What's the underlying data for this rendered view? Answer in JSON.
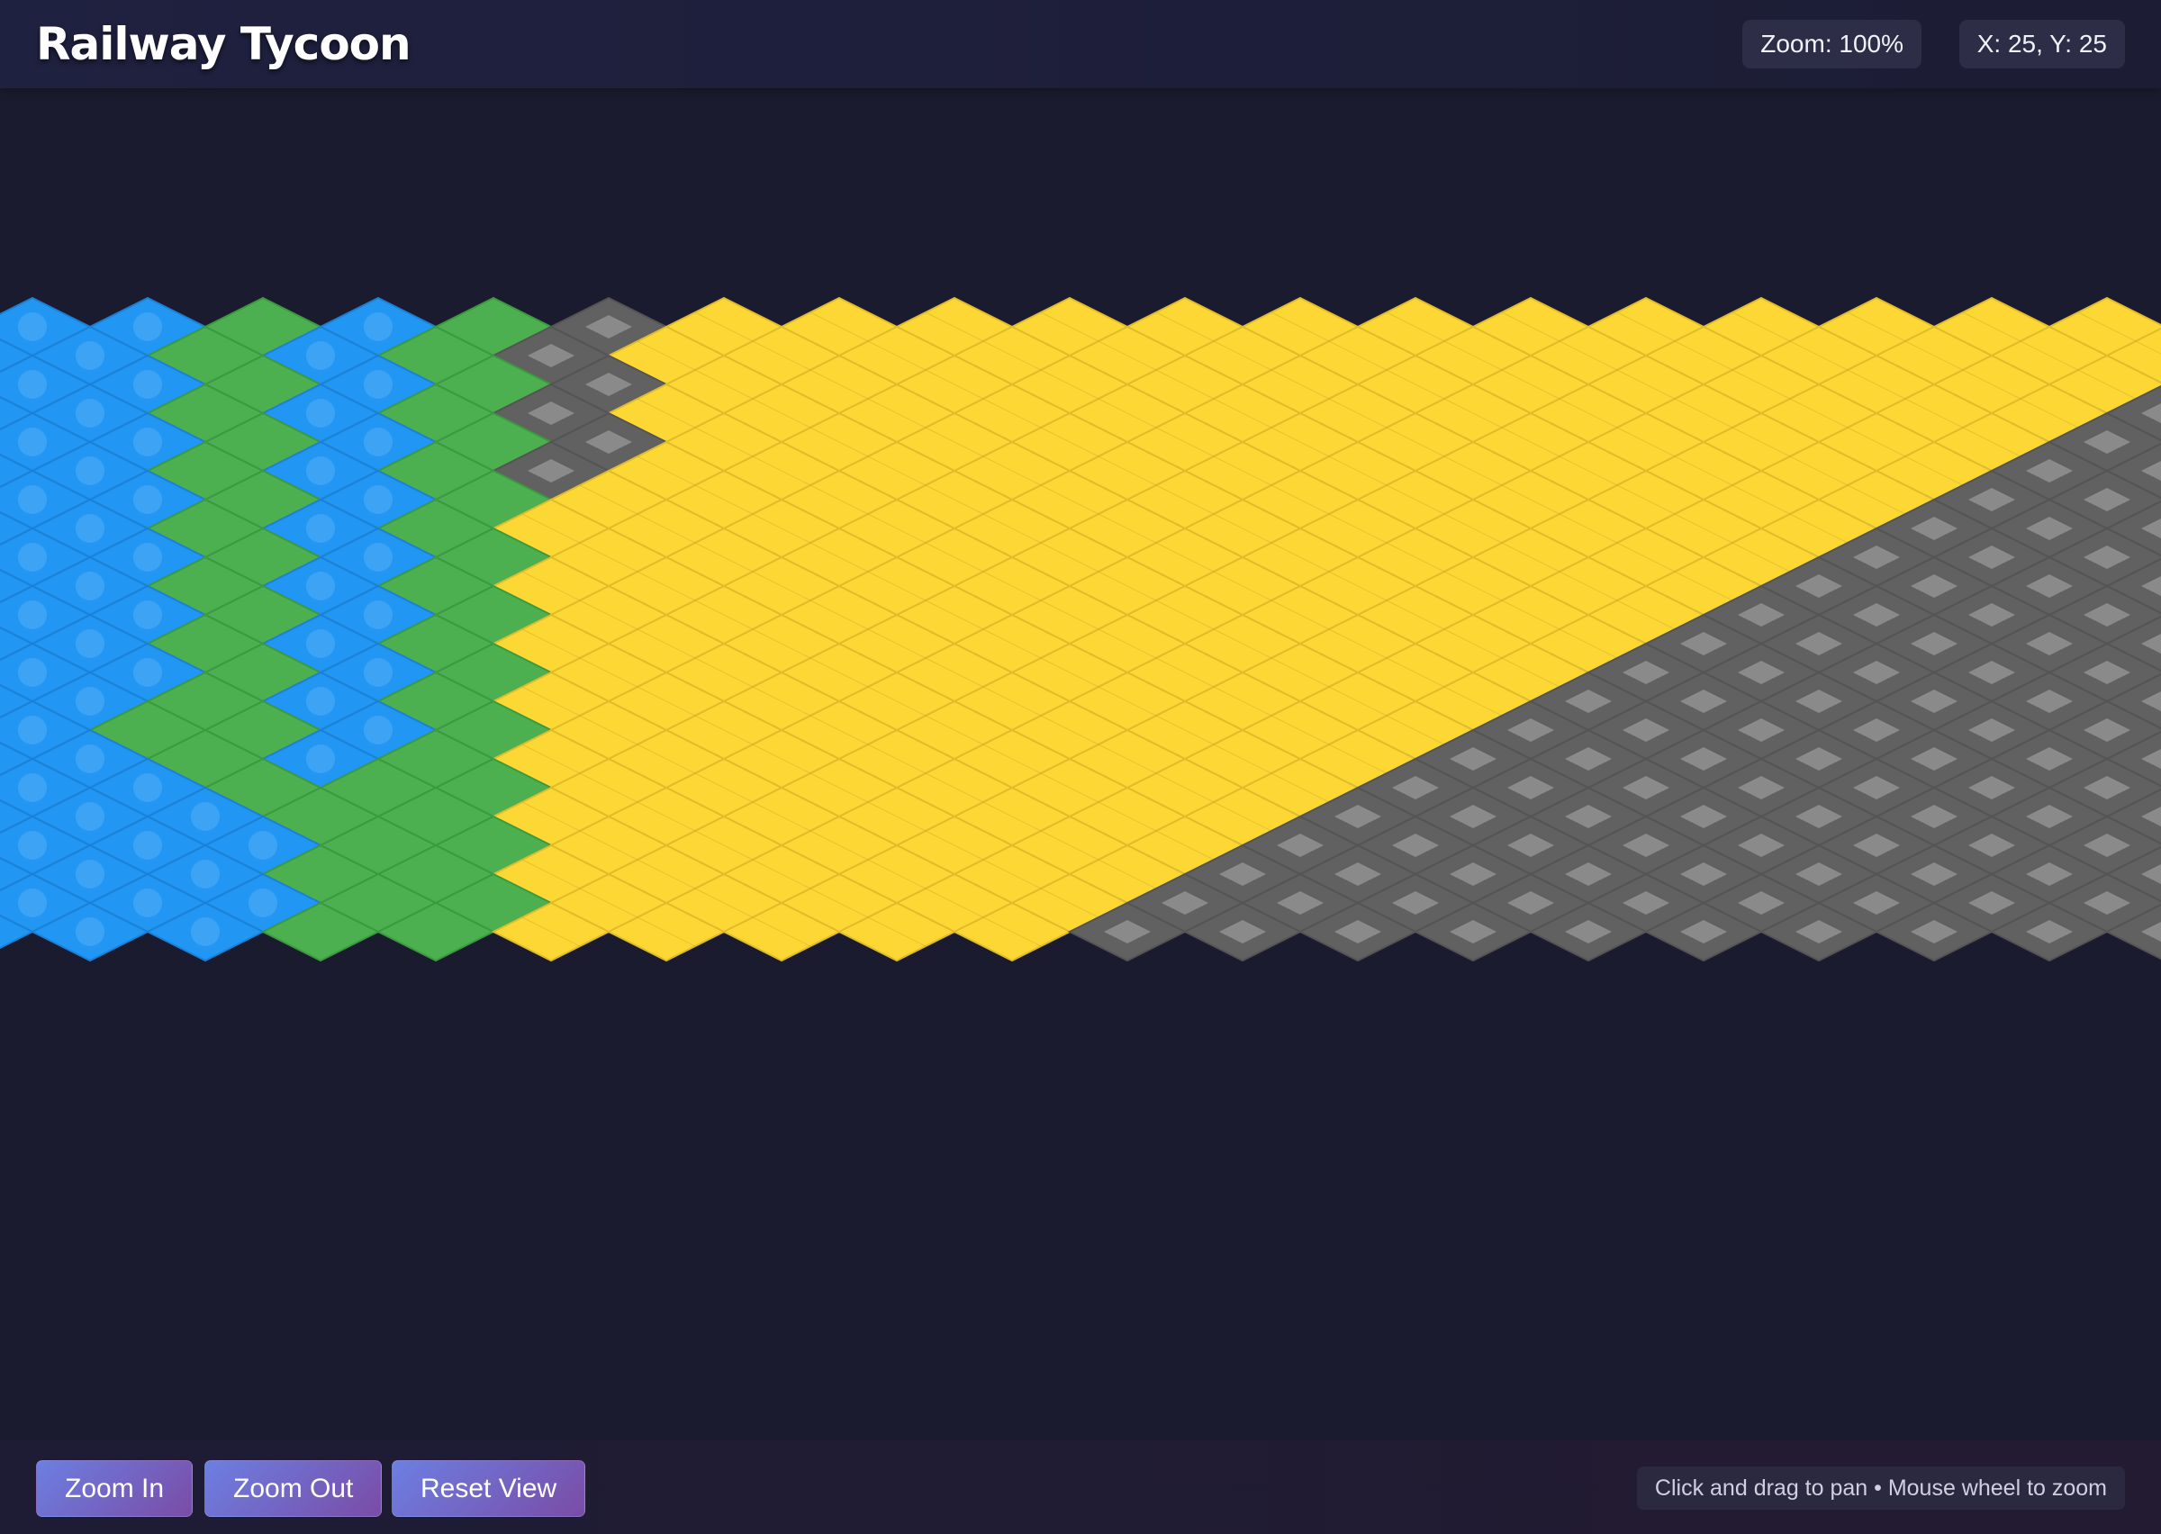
{
  "app": {
    "title": "Railway Tycoon"
  },
  "status": {
    "zoom": "Zoom: 100%",
    "coords": "X: 25, Y: 25"
  },
  "controls": {
    "zoom_in": "Zoom In",
    "zoom_out": "Zoom Out",
    "reset_view": "Reset View"
  },
  "hint": "Click and drag to pan • Mouse wheel to zoom",
  "terrain": {
    "colors": {
      "water": "#2196f3",
      "grass": "#4caf50",
      "sand": "#fdd835",
      "rock": "#616161",
      "background": "#1b1b2f"
    },
    "legend_order": [
      "water",
      "grass",
      "sand",
      "rock"
    ]
  }
}
